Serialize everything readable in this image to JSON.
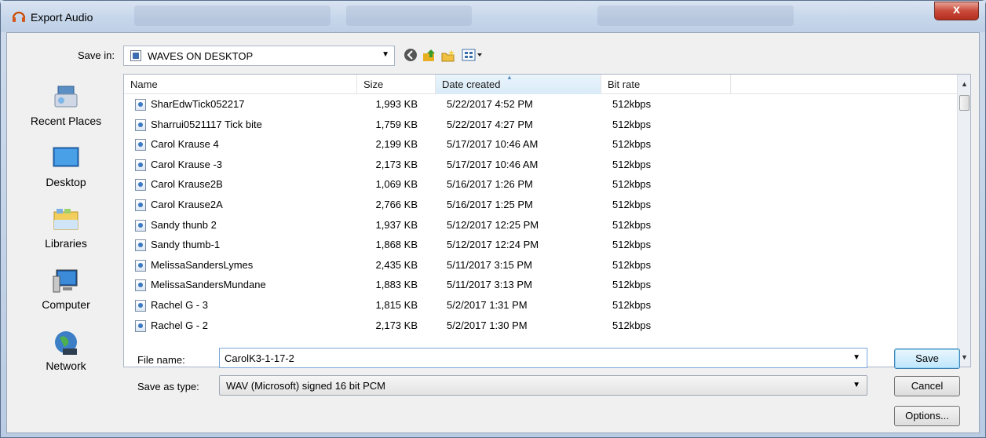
{
  "window": {
    "title": "Export Audio",
    "close_symbol": "x"
  },
  "toolbar": {
    "save_in_label": "Save in:",
    "save_in_value": "WAVES ON DESKTOP",
    "icons": [
      "back-icon",
      "up-folder-icon",
      "new-folder-icon",
      "view-menu-icon"
    ]
  },
  "places": [
    {
      "label": "Recent Places",
      "icon": "recent-places-icon"
    },
    {
      "label": "Desktop",
      "icon": "desktop-icon"
    },
    {
      "label": "Libraries",
      "icon": "libraries-icon"
    },
    {
      "label": "Computer",
      "icon": "computer-icon"
    },
    {
      "label": "Network",
      "icon": "network-icon"
    }
  ],
  "columns": [
    "Name",
    "Size",
    "Date created",
    "Bit rate"
  ],
  "sorted_column": "Date created",
  "files": [
    {
      "name": "SharEdwTick052217",
      "size": "1,993 KB",
      "date": "5/22/2017 4:52 PM",
      "bitrate": "512kbps"
    },
    {
      "name": "Sharrui0521117 Tick bite",
      "size": "1,759 KB",
      "date": "5/22/2017 4:27 PM",
      "bitrate": "512kbps"
    },
    {
      "name": "Carol Krause 4",
      "size": "2,199 KB",
      "date": "5/17/2017 10:46 AM",
      "bitrate": "512kbps"
    },
    {
      "name": "Carol Krause -3",
      "size": "2,173 KB",
      "date": "5/17/2017 10:46 AM",
      "bitrate": "512kbps"
    },
    {
      "name": "Carol Krause2B",
      "size": "1,069 KB",
      "date": "5/16/2017 1:26 PM",
      "bitrate": "512kbps"
    },
    {
      "name": "Carol Krause2A",
      "size": "2,766 KB",
      "date": "5/16/2017 1:25 PM",
      "bitrate": "512kbps"
    },
    {
      "name": "Sandy thunb 2",
      "size": "1,937 KB",
      "date": "5/12/2017 12:25 PM",
      "bitrate": "512kbps"
    },
    {
      "name": "Sandy thumb-1",
      "size": "1,868 KB",
      "date": "5/12/2017 12:24 PM",
      "bitrate": "512kbps"
    },
    {
      "name": "MelissaSandersLymes",
      "size": "2,435 KB",
      "date": "5/11/2017 3:15 PM",
      "bitrate": "512kbps"
    },
    {
      "name": "MelissaSandersMundane",
      "size": "1,883 KB",
      "date": "5/11/2017 3:13 PM",
      "bitrate": "512kbps"
    },
    {
      "name": "Rachel G - 3",
      "size": "1,815 KB",
      "date": "5/2/2017 1:31 PM",
      "bitrate": "512kbps"
    },
    {
      "name": "Rachel G - 2",
      "size": "2,173 KB",
      "date": "5/2/2017 1:30 PM",
      "bitrate": "512kbps"
    }
  ],
  "form": {
    "file_name_label": "File name:",
    "file_name_value": "CarolK3-1-17-2",
    "save_type_label": "Save as type:",
    "save_type_value": "WAV (Microsoft) signed 16 bit PCM"
  },
  "buttons": {
    "save": "Save",
    "cancel": "Cancel",
    "options": "Options..."
  },
  "colors": {
    "accent": "#3c7fb1",
    "close": "#c9493a",
    "selection_header": "#d9ebf7"
  }
}
